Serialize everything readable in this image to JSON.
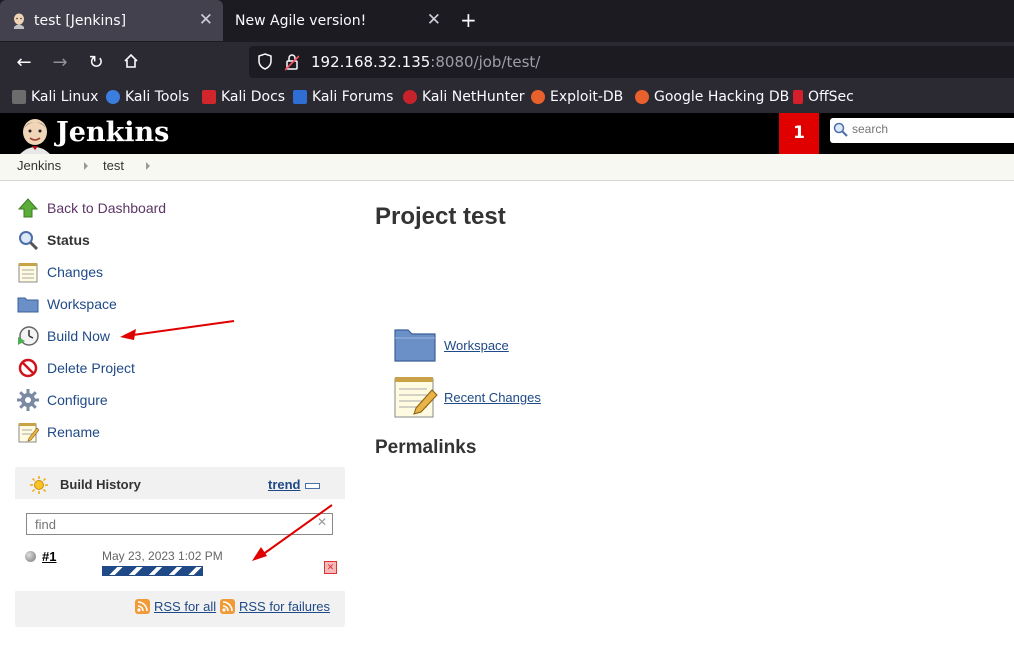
{
  "browser": {
    "tabs": [
      {
        "title": "test [Jenkins]"
      },
      {
        "title": "New Agile version!"
      }
    ],
    "url": {
      "host": "192.168.32.135",
      "rest": ":8080/job/test/"
    },
    "bookmarks": [
      "Kali Linux",
      "Kali Tools",
      "Kali Docs",
      "Kali Forums",
      "Kali NetHunter",
      "Exploit-DB",
      "Google Hacking DB",
      "OffSec"
    ]
  },
  "header": {
    "title": "Jenkins",
    "notification_count": "1",
    "search_placeholder": "search"
  },
  "breadcrumb": [
    "Jenkins",
    "test"
  ],
  "side": {
    "links": [
      "Back to Dashboard",
      "Status",
      "Changes",
      "Workspace",
      "Build Now",
      "Delete Project",
      "Configure",
      "Rename"
    ]
  },
  "build_history": {
    "title": "Build History",
    "trend": "trend",
    "find_placeholder": "find",
    "builds": [
      {
        "number": "#1",
        "date": "May 23, 2023 1:02 PM"
      }
    ],
    "rss_all": "RSS for all",
    "rss_failures": "RSS for failures"
  },
  "main": {
    "title": "Project test",
    "links": [
      "Workspace",
      "Recent Changes"
    ],
    "permalinks": "Permalinks"
  },
  "colors": {
    "link": "#204a87",
    "arrow": "#e00000",
    "header_bg": "#000000",
    "notification": "#e00000"
  }
}
